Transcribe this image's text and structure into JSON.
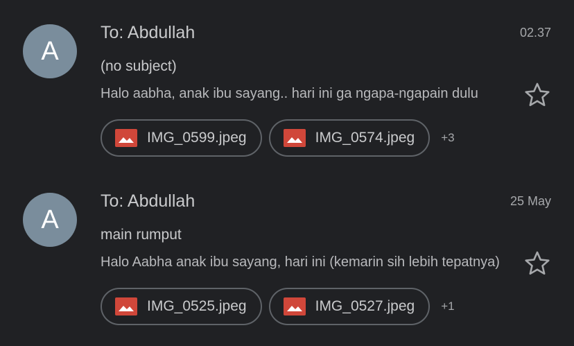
{
  "emails": [
    {
      "avatar_letter": "A",
      "sender": "To: Abdullah",
      "time": "02.37",
      "subject": "(no subject)",
      "snippet": "Halo aabha, anak ibu sayang.. hari ini ga ngapa-ngapain dulu",
      "attachments": [
        {
          "name": "IMG_0599.jpeg",
          "icon": "image-icon"
        },
        {
          "name": "IMG_0574.jpeg",
          "icon": "image-icon"
        }
      ],
      "more_attachments": "+3",
      "starred": false
    },
    {
      "avatar_letter": "A",
      "sender": "To: Abdullah",
      "time": "25 May",
      "subject": "main rumput",
      "snippet": "Halo Aabha anak ibu sayang, hari ini (kemarin sih lebih tepatnya)",
      "attachments": [
        {
          "name": "IMG_0525.jpeg",
          "icon": "image-icon"
        },
        {
          "name": "IMG_0527.jpeg",
          "icon": "image-icon"
        }
      ],
      "more_attachments": "+1",
      "starred": false
    }
  ],
  "colors": {
    "background": "#202124",
    "avatar": "#7a8d9c",
    "image_icon": "#d0473a",
    "chip_border": "#5f6368"
  }
}
